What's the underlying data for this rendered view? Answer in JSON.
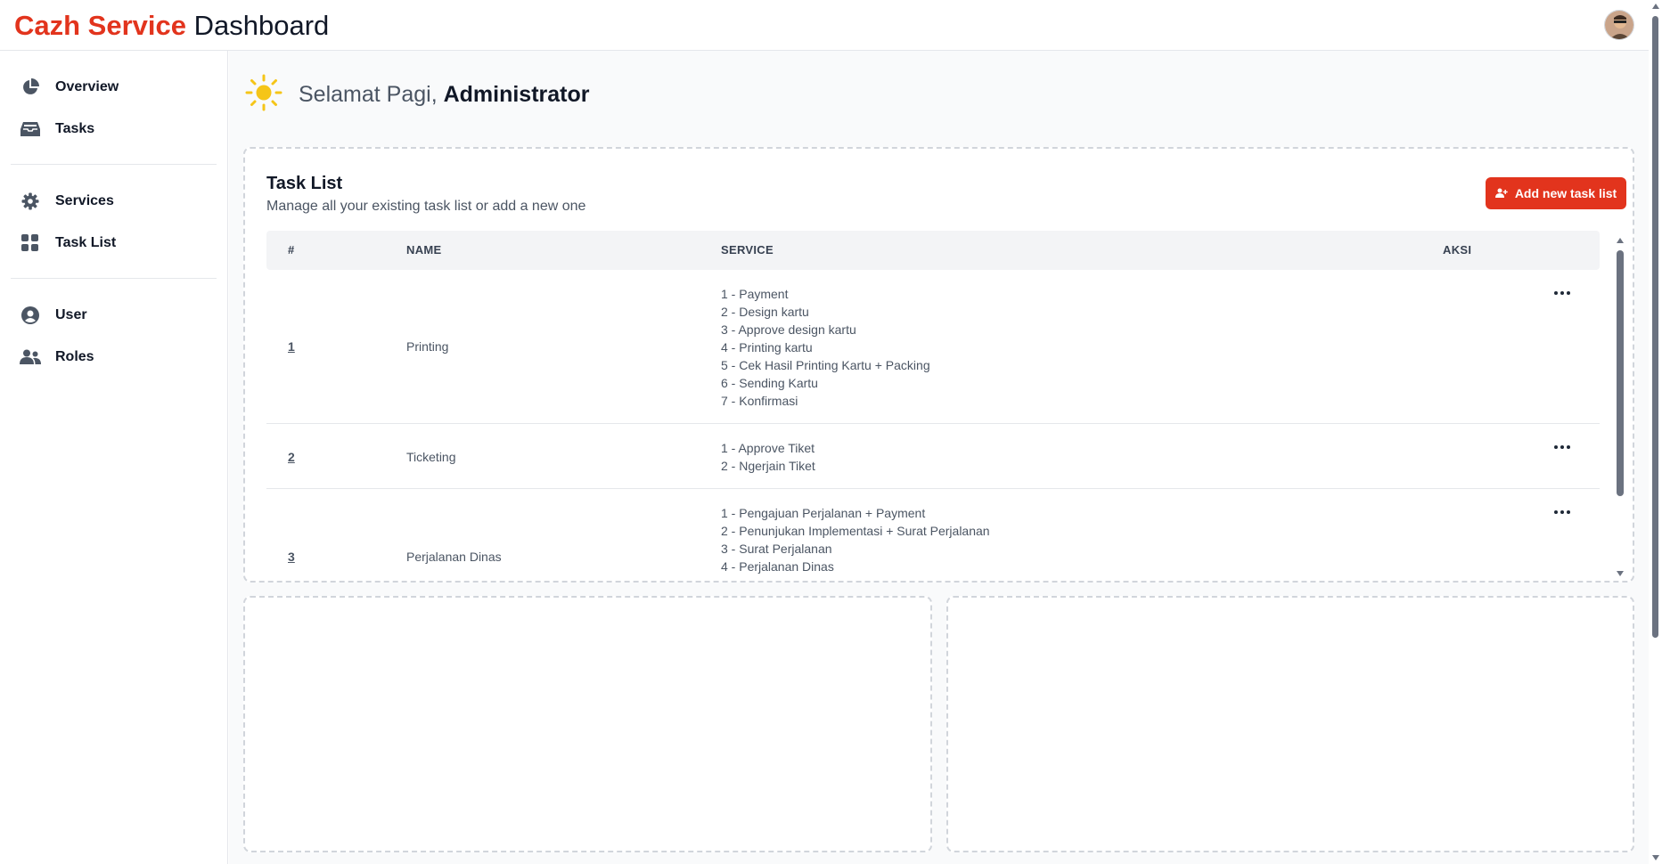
{
  "header": {
    "brand_accent": "Cazh Service",
    "brand_rest": "Dashboard",
    "avatar_icon": "user-avatar"
  },
  "sidebar": {
    "items": [
      {
        "label": "Overview",
        "icon": "pie-chart-icon"
      },
      {
        "label": "Tasks",
        "icon": "inbox-icon"
      },
      {
        "label": "Services",
        "icon": "gear-icon"
      },
      {
        "label": "Task List",
        "icon": "grid-icon"
      },
      {
        "label": "User",
        "icon": "user-circle-icon"
      },
      {
        "label": "Roles",
        "icon": "users-icon"
      }
    ]
  },
  "greeting": {
    "prefix": "Selamat Pagi,",
    "name": "Administrator",
    "icon": "sun-icon"
  },
  "task_list": {
    "title": "Task List",
    "subtitle": "Manage all your existing task list or add a new one",
    "add_button": "Add new task list",
    "columns": [
      "#",
      "NAME",
      "SERVICE",
      "AKSI"
    ],
    "rows": [
      {
        "num": "1",
        "name": "Printing",
        "services": [
          "1 - Payment",
          "2 - Design kartu",
          "3 - Approve design kartu",
          "4 - Printing kartu",
          "5 - Cek Hasil Printing Kartu + Packing",
          "6 - Sending Kartu",
          "7 - Konfirmasi"
        ]
      },
      {
        "num": "2",
        "name": "Ticketing",
        "services": [
          "1 - Approve Tiket",
          "2 - Ngerjain Tiket"
        ]
      },
      {
        "num": "3",
        "name": "Perjalanan Dinas",
        "services": [
          "1 - Pengajuan Perjalanan + Payment",
          "2 - Penunjukan Implementasi + Surat Perjalanan",
          "3 - Surat Perjalanan",
          "4 - Perjalanan Dinas"
        ]
      }
    ]
  },
  "colors": {
    "accent": "#e2341d",
    "sun": "#f5c518"
  }
}
